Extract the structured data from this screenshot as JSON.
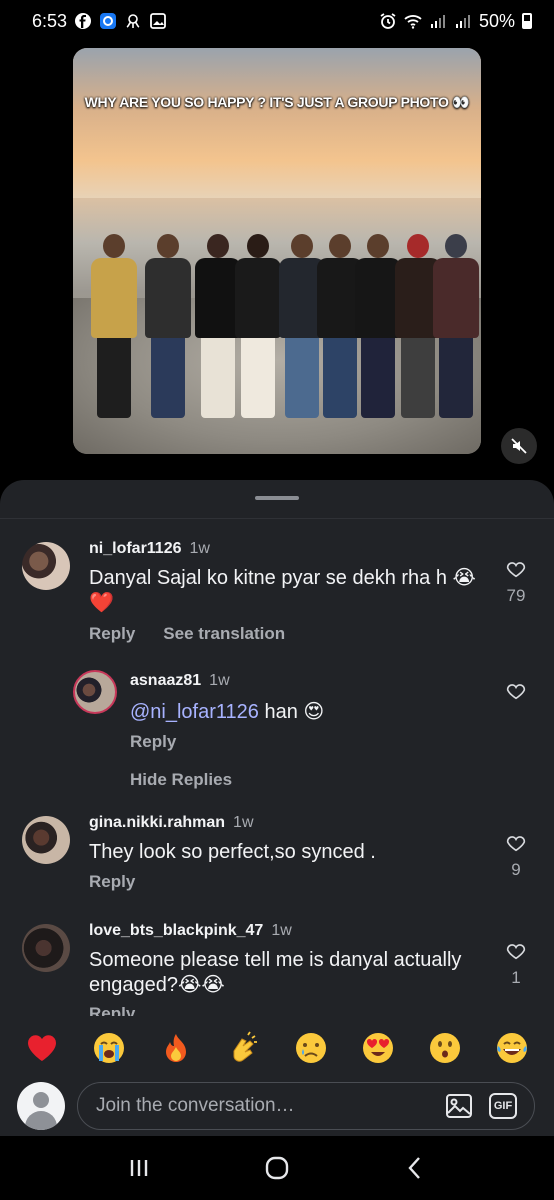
{
  "status_bar": {
    "time": "6:53",
    "battery": "50%",
    "icons": [
      "facebook-icon",
      "app-icon",
      "octopus-icon",
      "gallery-icon",
      "alarm-icon",
      "wifi-icon",
      "signal-icon",
      "signal-icon-2",
      "battery-icon"
    ]
  },
  "video": {
    "caption": "WHY ARE YOU SO HAPPY ? IT'S JUST A GROUP PHOTO 👀",
    "mute_icon": "mute-icon"
  },
  "comments": [
    {
      "username": "ni_lofar1126",
      "time": "1w",
      "text": "Danyal Sajal ko kitne pyar se dekh rha h 😭❤️",
      "likes": "79",
      "reply_label": "Reply",
      "translate_label": "See translation"
    },
    {
      "username": "asnaaz81",
      "time": "1w",
      "mention": "@ni_lofar1126",
      "text": " han 😍",
      "likes": "",
      "reply_label": "Reply",
      "hide_replies_label": "Hide Replies"
    },
    {
      "username": "gina.nikki.rahman",
      "time": "1w",
      "text": "They look so perfect,so synced .",
      "likes": "9",
      "reply_label": "Reply"
    },
    {
      "username": "love_bts_blackpink_47",
      "time": "1w",
      "text": "Someone please tell me is danyal actually engaged?😭😭",
      "likes": "1",
      "reply_label": "Reply"
    }
  ],
  "emoji_bar": [
    "heart",
    "loudly-crying",
    "fire",
    "clapping-hands",
    "crying",
    "heart-eyes",
    "astonished",
    "tears-of-joy"
  ],
  "input": {
    "placeholder": "Join the conversation…",
    "gif_label": "GIF"
  },
  "colors": {
    "sheet_bg": "#212327",
    "mention": "#a8b3ff",
    "muted_text": "#a8abb1",
    "heart_red": "#e8212e"
  }
}
